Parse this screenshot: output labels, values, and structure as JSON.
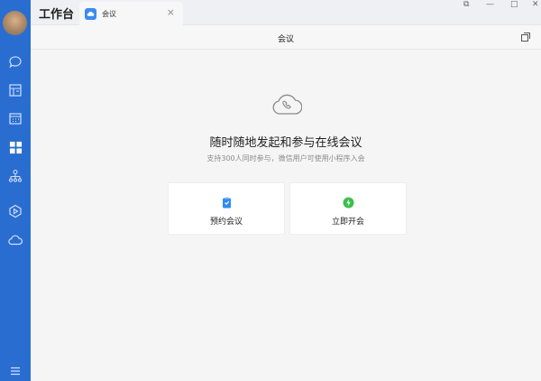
{
  "app": {
    "title": "工作台"
  },
  "tab": {
    "label": "会议",
    "close_glyph": "×"
  },
  "window": {
    "controls": [
      "⧉",
      "—",
      "□",
      "✕"
    ]
  },
  "header": {
    "title": "会议"
  },
  "sidebar": {
    "items": [
      {
        "name": "chat-icon"
      },
      {
        "name": "doc-icon"
      },
      {
        "name": "calendar-icon"
      },
      {
        "name": "workspace-icon",
        "active": true
      },
      {
        "name": "org-chart-icon"
      },
      {
        "name": "play-icon"
      },
      {
        "name": "cloud-icon"
      },
      {
        "name": "menu-icon"
      }
    ]
  },
  "main": {
    "headline": "随时随地发起和参与在线会议",
    "subline": "支持300人同时参与，微信用户可使用小程序入会",
    "cards": [
      {
        "id": "schedule",
        "label": "预约会议",
        "icon": "clipboard-icon",
        "color": "#2f8cf0"
      },
      {
        "id": "start",
        "label": "立即开会",
        "icon": "lightning-icon",
        "color": "#3bbf4a"
      }
    ]
  },
  "colors": {
    "sidebar": "#2a6dd0",
    "accent": "#3a8cf2"
  }
}
